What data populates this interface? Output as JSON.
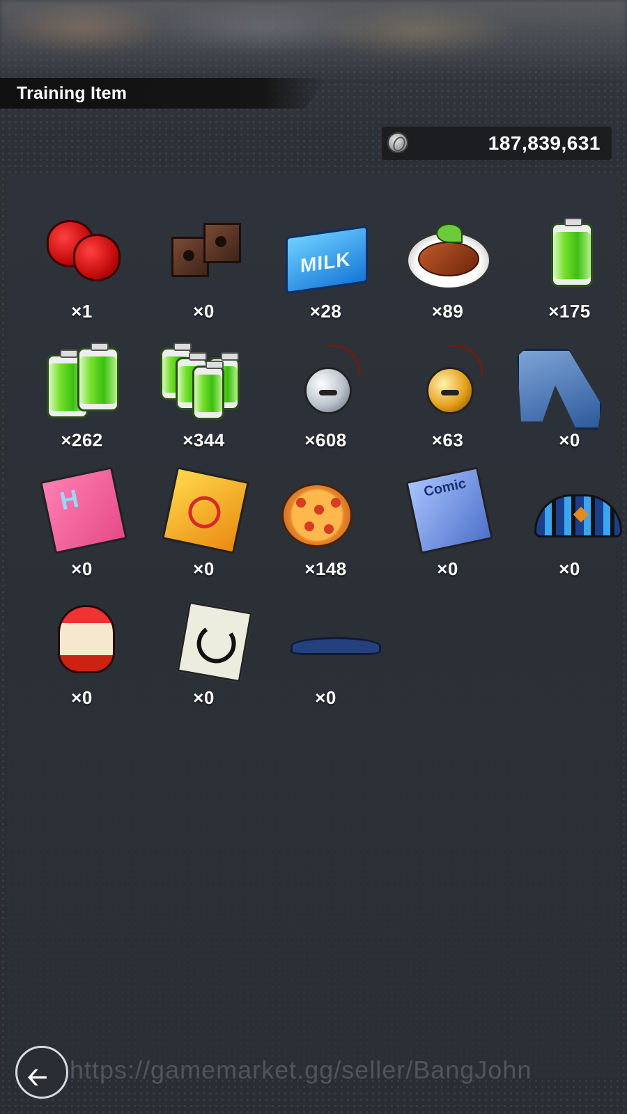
{
  "header": {
    "title": "Training Item"
  },
  "currency": {
    "icon": "zeni-coin-icon",
    "value": "187,839,631"
  },
  "items": [
    {
      "icon": "red-weights-icon",
      "count": "×1"
    },
    {
      "icon": "brick-weights-icon",
      "count": "×0"
    },
    {
      "icon": "milk-carton-icon",
      "count": "×28",
      "label": "MILK"
    },
    {
      "icon": "fish-dish-icon",
      "count": "×89"
    },
    {
      "icon": "battery-icon",
      "count": "×175"
    },
    {
      "icon": "double-battery-icon",
      "count": "×262"
    },
    {
      "icon": "battery-pack-icon",
      "count": "×344"
    },
    {
      "icon": "silver-bell-icon",
      "count": "×608"
    },
    {
      "icon": "gold-bell-icon",
      "count": "×63"
    },
    {
      "icon": "jeans-icon",
      "count": "×0"
    },
    {
      "icon": "pink-book-icon",
      "count": "×0"
    },
    {
      "icon": "yellow-book-icon",
      "count": "×0"
    },
    {
      "icon": "pizza-icon",
      "count": "×148"
    },
    {
      "icon": "comic-book-icon",
      "count": "×0"
    },
    {
      "icon": "wristband-icon",
      "count": "×0"
    },
    {
      "icon": "ramen-cup-icon",
      "count": "×0"
    },
    {
      "icon": "symbol-card-icon",
      "count": "×0"
    },
    {
      "icon": "headband-icon",
      "count": "×0"
    }
  ],
  "footer": {
    "back_icon": "back-arrow-icon",
    "back_glyph": "🡠",
    "watermark": "https://gamemarket.gg/seller/BangJohn"
  }
}
